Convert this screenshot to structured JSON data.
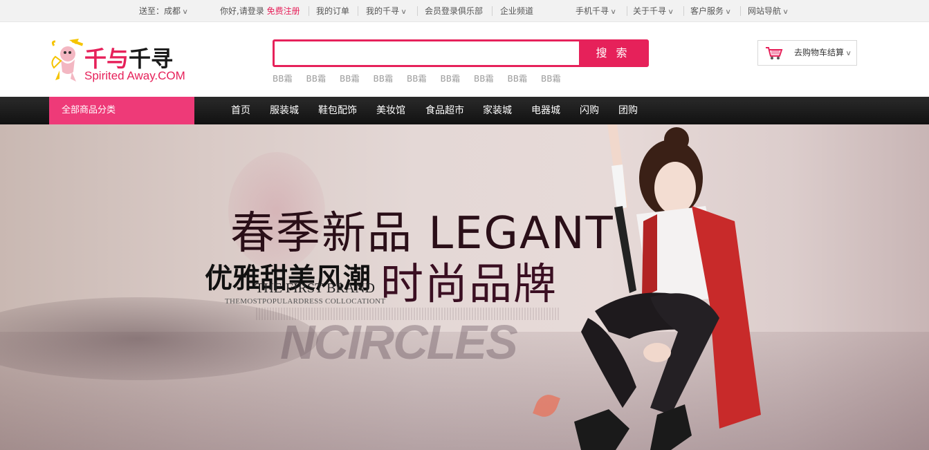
{
  "topbar": {
    "delivery_label": "送至：成都",
    "greeting": "你好,请登录",
    "register": "免费注册",
    "my_orders": "我的订单",
    "my_account": "我的千寻",
    "club": "会员登录俱乐部",
    "enterprise": "企业频道",
    "mobile": "手机千寻",
    "about": "关于千寻",
    "service": "客户服务",
    "site_nav": "网站导航",
    "caret": "∨"
  },
  "header": {
    "logo_cn_a": "千与",
    "logo_cn_b": "千寻",
    "logo_en": "Spirited Away.COM",
    "search_value": "",
    "search_button": "搜 索",
    "hotwords": [
      "BB霜",
      "BB霜",
      "BB霜",
      "BB霜",
      "BB霜",
      "BB霜",
      "BB霜",
      "BB霜",
      "BB霜"
    ],
    "cart_label": "去购物车结算"
  },
  "nav": {
    "all_categories": "全部商品分类",
    "links": [
      "首页",
      "服装城",
      "鞋包配饰",
      "美妆馆",
      "食品超市",
      "家装城",
      "电器城",
      "闪购",
      "团购"
    ]
  },
  "banner": {
    "headline": "春季新品 LEGANT",
    "subline_a": "优雅甜美风潮",
    "subline_b": "时尚品牌",
    "brand": "THE FIRST BRAND",
    "tagline": "THEMOSTPOPULARDRESS COLLOCATIONT",
    "ghost": "NCIRCLES"
  },
  "colors": {
    "accent": "#e6215a",
    "category_bar": "#ee3a78",
    "nav_bg": "#1c1c1c"
  }
}
